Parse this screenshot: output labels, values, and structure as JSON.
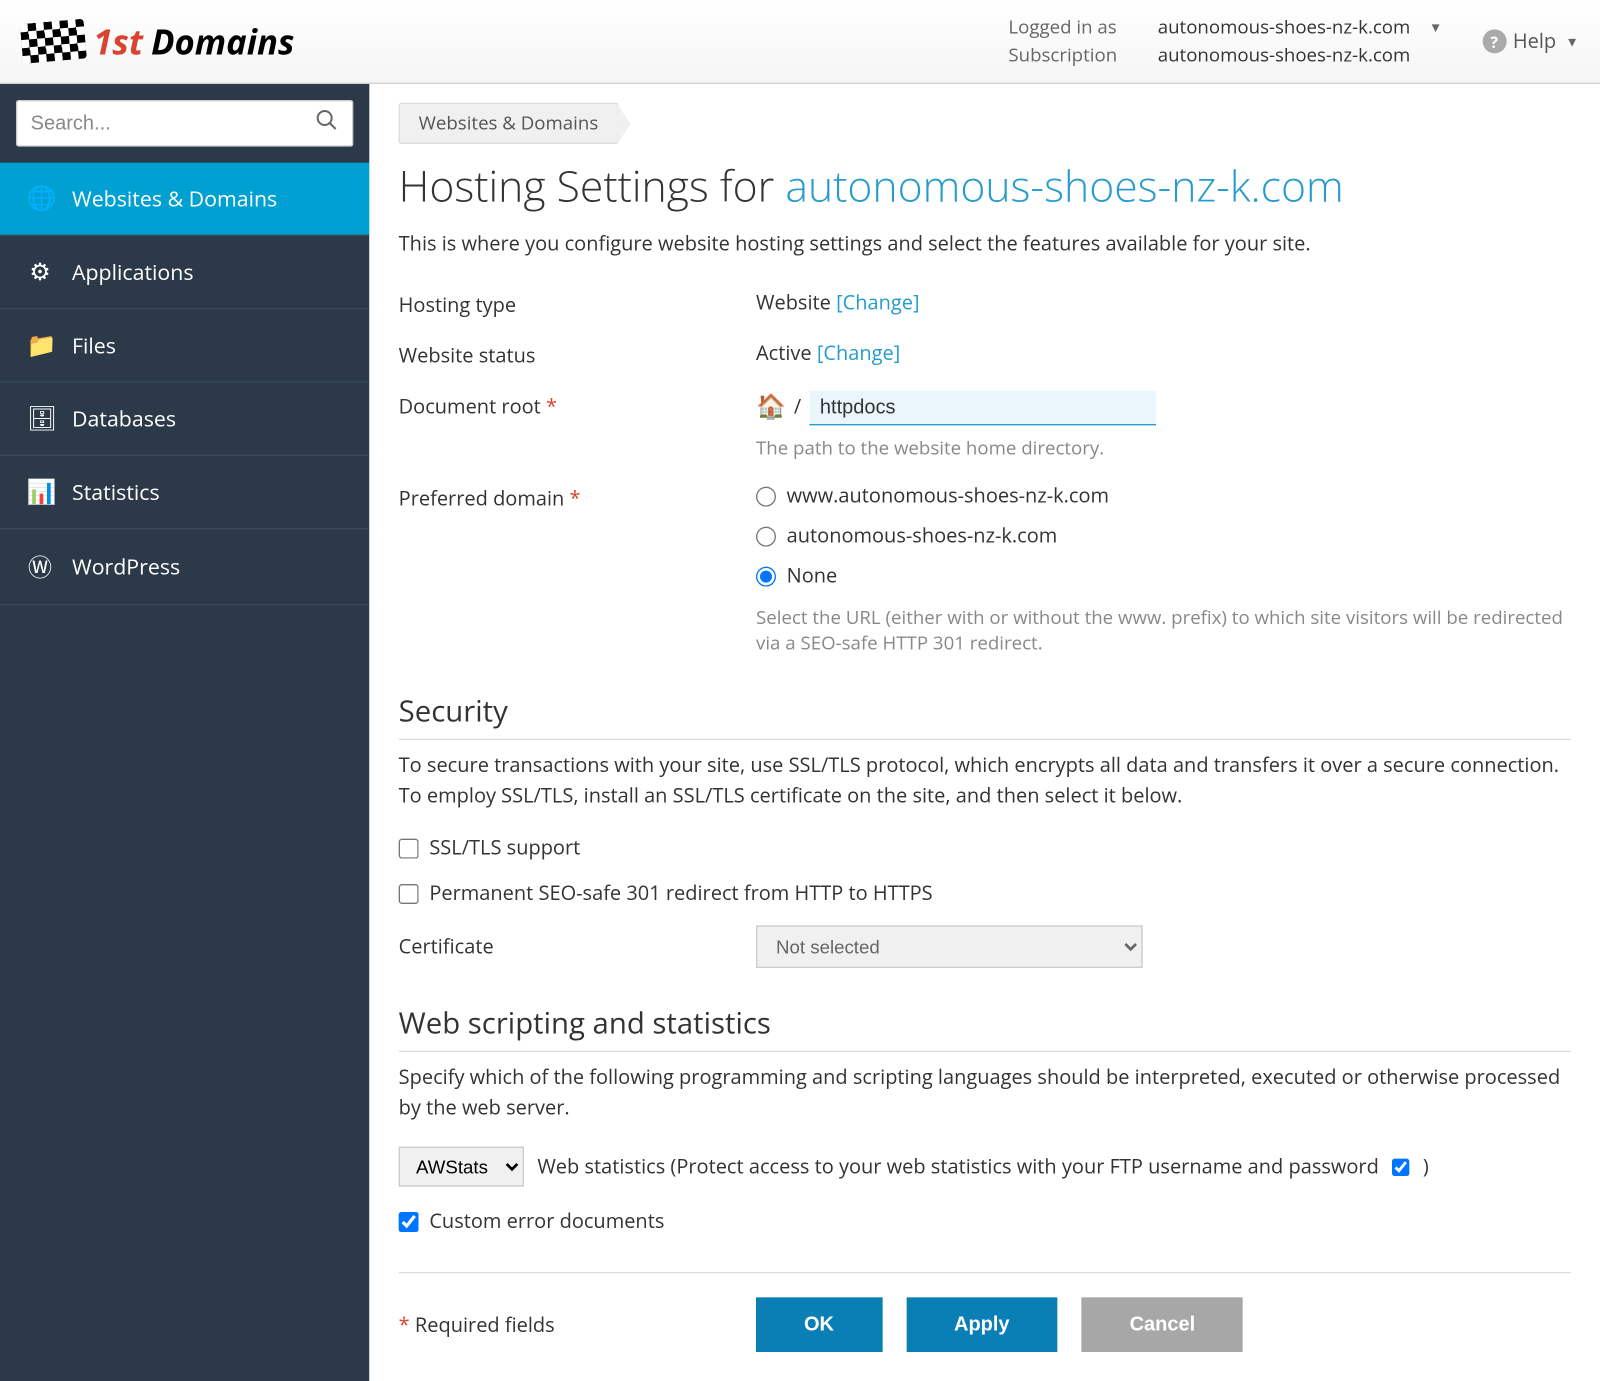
{
  "header": {
    "logo_text": "Domains",
    "logged_in_label": "Logged in as",
    "logged_in_value": "autonomous-shoes-nz-k.com",
    "subscription_label": "Subscription",
    "subscription_value": "autonomous-shoes-nz-k.com",
    "help_label": "Help"
  },
  "sidebar": {
    "search_placeholder": "Search...",
    "items": [
      {
        "label": "Websites & Domains"
      },
      {
        "label": "Applications"
      },
      {
        "label": "Files"
      },
      {
        "label": "Databases"
      },
      {
        "label": "Statistics"
      },
      {
        "label": "WordPress"
      }
    ]
  },
  "breadcrumb": "Websites & Domains",
  "page": {
    "title_prefix": "Hosting Settings for ",
    "domain": "autonomous-shoes-nz-k.com"
  },
  "intro": "This is where you configure website hosting settings and select the features available for your site.",
  "hosting_type": {
    "label": "Hosting type",
    "value": "Website",
    "change": "[Change]"
  },
  "status": {
    "label": "Website status",
    "value": "Active",
    "change": "[Change]"
  },
  "docroot": {
    "label": "Document root",
    "value": "httpdocs",
    "hint": "The path to the website home directory."
  },
  "preferred_domain": {
    "label": "Preferred domain",
    "options": [
      "www.autonomous-shoes-nz-k.com",
      "autonomous-shoes-nz-k.com",
      "None"
    ],
    "hint": "Select the URL (either with or without the www. prefix) to which site visitors will be redirected via a SEO-safe HTTP 301 redirect."
  },
  "security": {
    "title": "Security",
    "desc": "To secure transactions with your site, use SSL/TLS protocol, which encrypts all data and transfers it over a secure connection. To employ SSL/TLS, install an SSL/TLS certificate on the site, and then select it below.",
    "ssl_label": "SSL/TLS support",
    "redirect_label": "Permanent SEO-safe 301 redirect from HTTP to HTTPS",
    "cert_label": "Certificate",
    "cert_value": "Not selected"
  },
  "stats": {
    "title": "Web scripting and statistics",
    "desc": "Specify which of the following programming and scripting languages should be interpreted, executed or otherwise processed by the web server.",
    "statistics_value": "AWStats",
    "statistics_label": "Web statistics (Protect access to your web statistics with your FTP username and password",
    "closing_paren": ")",
    "custom_errors": "Custom error documents"
  },
  "footer": {
    "required": "Required fields",
    "ok": "OK",
    "apply": "Apply",
    "cancel": "Cancel"
  }
}
